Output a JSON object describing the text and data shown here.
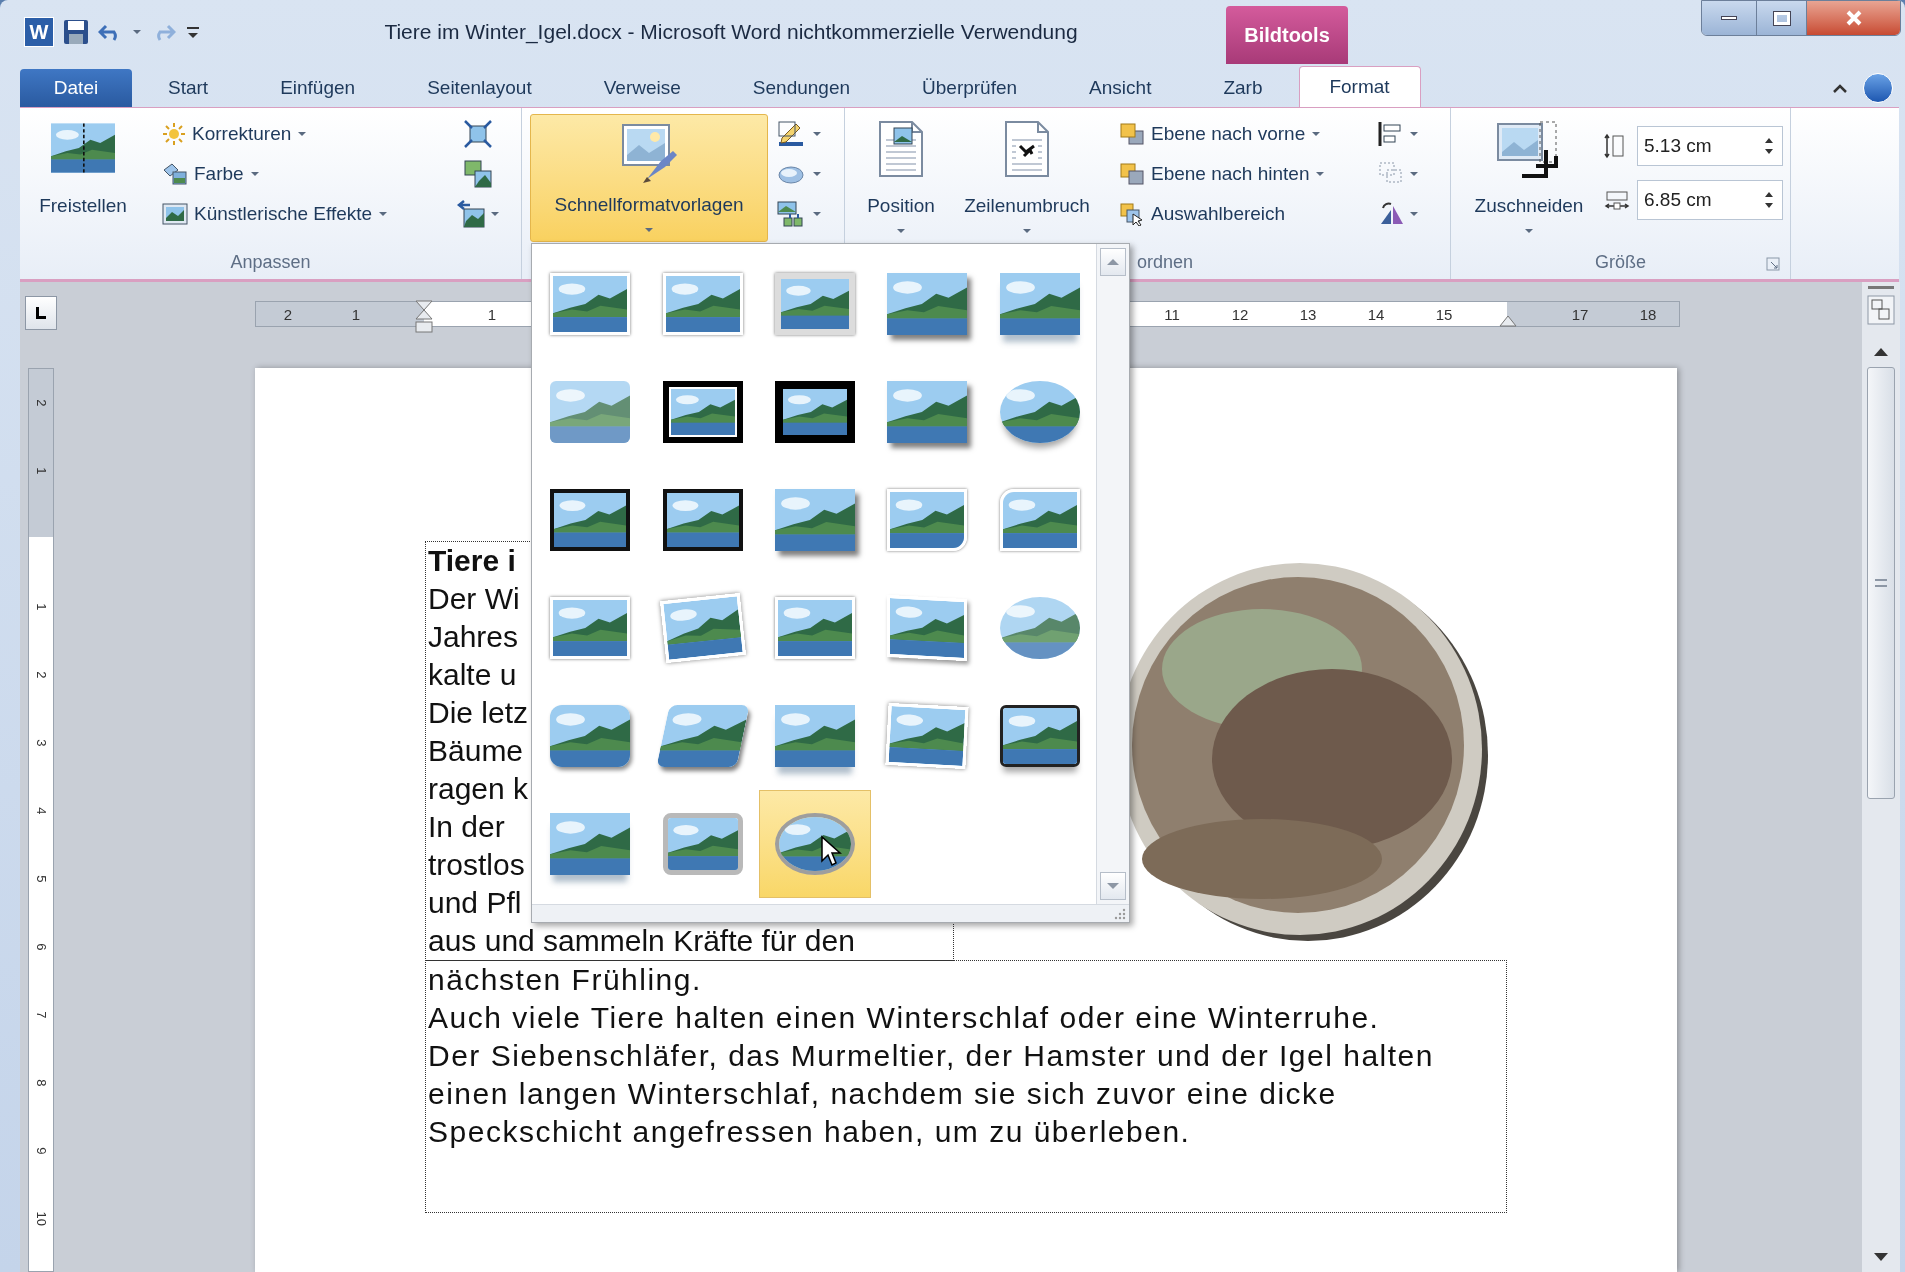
{
  "window": {
    "app_icon": "W",
    "title": "Tiere im Winter_Igel.docx - Microsoft Word nichtkommerzielle Verwendung",
    "context_tab": "Bildtools"
  },
  "tabs": [
    {
      "label": "Datei",
      "kind": "file",
      "selected": false
    },
    {
      "label": "Start",
      "kind": "tab",
      "selected": false
    },
    {
      "label": "Einfügen",
      "kind": "tab",
      "selected": false
    },
    {
      "label": "Seitenlayout",
      "kind": "tab",
      "selected": false
    },
    {
      "label": "Verweise",
      "kind": "tab",
      "selected": false
    },
    {
      "label": "Sendungen",
      "kind": "tab",
      "selected": false
    },
    {
      "label": "Überprüfen",
      "kind": "tab",
      "selected": false
    },
    {
      "label": "Ansicht",
      "kind": "tab",
      "selected": false
    },
    {
      "label": "Zarb",
      "kind": "tab",
      "selected": false
    },
    {
      "label": "Format",
      "kind": "tab",
      "selected": true
    }
  ],
  "ribbon": {
    "adjust": {
      "label": "Anpassen",
      "remove_background": "Freistellen",
      "commands": [
        {
          "label": "Korrekturen",
          "dropdown": true
        },
        {
          "label": "Farbe",
          "dropdown": true
        },
        {
          "label": "Künstlerische Effekte",
          "dropdown": true
        }
      ]
    },
    "styles": {
      "quick_styles": {
        "label": "Schnellformatvorlagen",
        "open": true
      }
    },
    "arrange": {
      "label": "ordnen",
      "position": "Position",
      "wrap_text": "Zeilenumbruch",
      "commands": [
        {
          "label": "Ebene nach vorne",
          "dropdown": true
        },
        {
          "label": "Ebene nach hinten",
          "dropdown": true
        },
        {
          "label": "Auswahlbereich",
          "dropdown": false
        }
      ]
    },
    "size": {
      "label": "Größe",
      "crop": "Zuschneiden",
      "height": "5.13 cm",
      "width": "6.85 cm"
    }
  },
  "ruler": {
    "left_numbers": [
      "2",
      "1",
      "1"
    ],
    "right_numbers": [
      "11",
      "12",
      "13",
      "14",
      "15",
      "17",
      "18"
    ],
    "vertical_numbers": [
      "2",
      "1",
      "1",
      "2",
      "3",
      "4",
      "5",
      "6",
      "7",
      "8",
      "9",
      "10"
    ]
  },
  "gallery": {
    "items": [
      {
        "kind": "plain",
        "selected": false
      },
      {
        "kind": "plain",
        "selected": false
      },
      {
        "kind": "grey-frame",
        "selected": false
      },
      {
        "kind": "shadow",
        "selected": false
      },
      {
        "kind": "reflection",
        "selected": false
      },
      {
        "kind": "soft-edge",
        "selected": false
      },
      {
        "kind": "double-black",
        "selected": false
      },
      {
        "kind": "thick-black",
        "selected": false
      },
      {
        "kind": "shadow",
        "selected": false
      },
      {
        "kind": "oval",
        "selected": false
      },
      {
        "kind": "black-frame",
        "selected": false
      },
      {
        "kind": "black-frame",
        "selected": false
      },
      {
        "kind": "shadow",
        "selected": false
      },
      {
        "kind": "rounded-corner",
        "selected": false
      },
      {
        "kind": "clipped",
        "selected": false
      },
      {
        "kind": "plain",
        "selected": false
      },
      {
        "kind": "rotated",
        "selected": false
      },
      {
        "kind": "plain",
        "selected": false
      },
      {
        "kind": "perspective",
        "selected": false
      },
      {
        "kind": "oval-soft",
        "selected": false
      },
      {
        "kind": "rounded",
        "selected": false
      },
      {
        "kind": "bevel",
        "selected": false
      },
      {
        "kind": "reflection",
        "selected": false
      },
      {
        "kind": "tilted-frame",
        "selected": false
      },
      {
        "kind": "rounded-black",
        "selected": false
      },
      {
        "kind": "reflection",
        "selected": false
      },
      {
        "kind": "rounded-grey",
        "selected": false
      },
      {
        "kind": "oval-grey",
        "selected": true
      }
    ]
  },
  "document": {
    "text_box_lines": [
      {
        "text": "Tiere i",
        "bold": true
      },
      {
        "text": "Der Wi",
        "bold": false
      },
      {
        "text": "Jahres",
        "bold": false
      },
      {
        "text": "kalte u",
        "bold": false
      },
      {
        "text": "Die letz",
        "bold": false
      },
      {
        "text": "Bäume",
        "bold": false
      },
      {
        "text": "ragen k",
        "bold": false
      },
      {
        "text": "In der",
        "bold": false
      },
      {
        "text": "trostlos",
        "bold": false
      },
      {
        "text": "und Pfl",
        "bold": false
      },
      {
        "text": "aus und sammeln Kräfte für den",
        "bold": false
      }
    ],
    "body_lines": [
      "nächsten Frühling.",
      "Auch viele Tiere halten einen Winterschlaf oder eine Winterruhe.",
      "Der Siebenschläfer, das Murmeltier, der Hamster und der Igel halten",
      "einen langen Winterschlaf, nachdem sie sich zuvor eine dicke",
      "Speckschicht angefressen haben, um zu überleben."
    ]
  }
}
